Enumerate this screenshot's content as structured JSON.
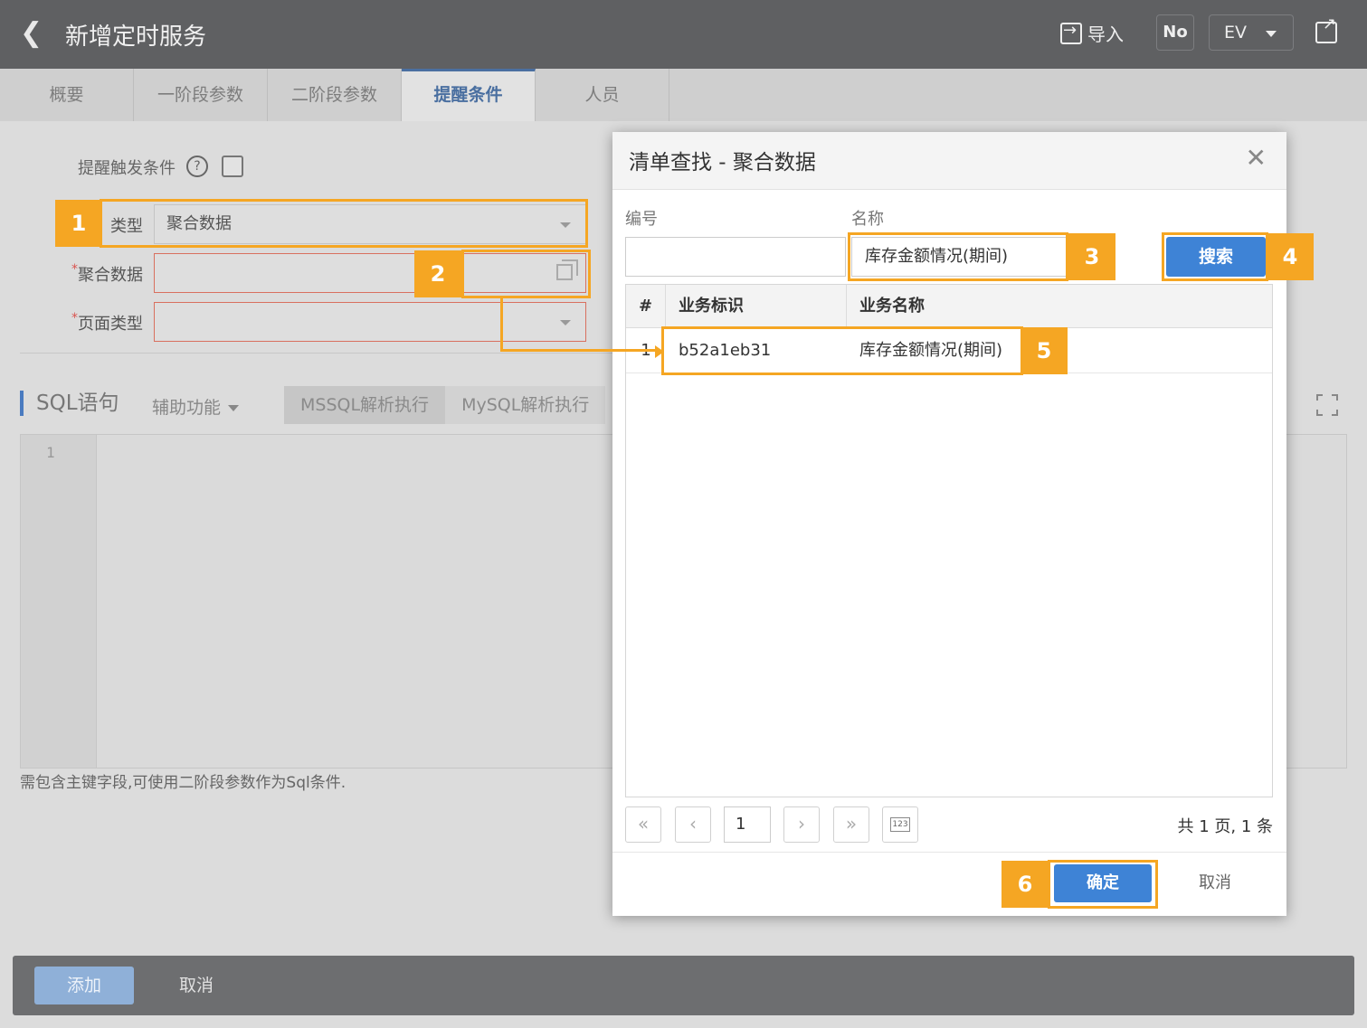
{
  "header": {
    "title": "新增定时服务",
    "import_label": "导入",
    "no_label": "No",
    "lang_label": "EV"
  },
  "tabs": [
    {
      "label": "概要"
    },
    {
      "label": "一阶段参数"
    },
    {
      "label": "二阶段参数"
    },
    {
      "label": "提醒条件",
      "active": true
    },
    {
      "label": "人员"
    }
  ],
  "form": {
    "trigger_label": "提醒触发条件",
    "help_symbol": "?",
    "type_label": "类型",
    "type_value": "聚合数据",
    "agg_label": "聚合数据",
    "agg_value": "",
    "page_type_label": "页面类型",
    "page_type_value": "",
    "required_mark": "*"
  },
  "sql": {
    "title": "SQL语句",
    "assist_label": "辅助功能",
    "mssql_label": "MSSQL解析执行",
    "mysql_label": "MySQL解析执行",
    "line_number": "1",
    "hint": "需包含主键字段,可使用二阶段参数作为Sql条件."
  },
  "footer": {
    "add_label": "添加",
    "cancel_label": "取消"
  },
  "dialog": {
    "title": "清单查找 - 聚合数据",
    "close_symbol": "✕",
    "code_label": "编号",
    "code_value": "",
    "name_label": "名称",
    "name_value": "库存金额情况(期间)",
    "search_label": "搜索",
    "columns": [
      "#",
      "业务标识",
      "业务名称"
    ],
    "rows": [
      {
        "index": "1",
        "id": "b52a1eb31",
        "name": "库存金额情况(期间)"
      }
    ],
    "pager": {
      "first": "«",
      "prev": "‹",
      "page": "1",
      "next": "›",
      "last": "»",
      "jump_icon_text": "123",
      "info": "共 1 页, 1 条"
    },
    "ok_label": "确定",
    "cancel_label": "取消"
  },
  "annotations": [
    "1",
    "2",
    "3",
    "4",
    "5",
    "6"
  ],
  "colors": {
    "accent": "#f5a623",
    "primary": "#3e83d6",
    "header_bg": "#5f6062"
  }
}
